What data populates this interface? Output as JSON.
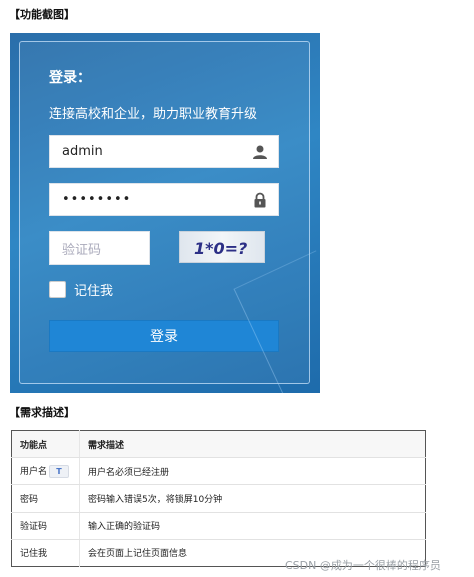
{
  "sections": {
    "feature_screenshot": "【功能截图】",
    "requirements": "【需求描述】"
  },
  "login": {
    "heading": "登录：",
    "subtitle": "连接高校和企业，助力职业教育升级",
    "username_value": "admin",
    "password_value": "••••••••",
    "captcha_placeholder": "验证码",
    "captcha_text": "1*0=?",
    "remember_label": "记住我",
    "remember_checked": false,
    "submit_label": "登录",
    "icons": {
      "username": "user-icon",
      "password": "lock-icon"
    },
    "colors": {
      "panel": "#2f86c4",
      "button": "#1f86d6"
    }
  },
  "table": {
    "headers": [
      "功能点",
      "需求描述"
    ],
    "rows": [
      [
        "用户名",
        "用户名必须已经注册"
      ],
      [
        "密码",
        "密码输入错误5次，将锁屏10分钟"
      ],
      [
        "验证码",
        "输入正确的验证码"
      ],
      [
        "记住我",
        "会在页面上记住页面信息"
      ]
    ],
    "badge_icon": "text-tool-icon",
    "badge_text": "T"
  },
  "watermark": "CSDN @成为一个很棒的程序员"
}
